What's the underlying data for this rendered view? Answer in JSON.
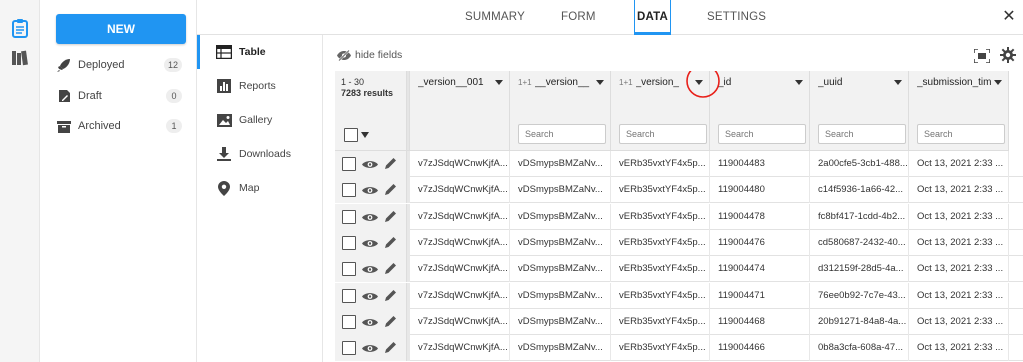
{
  "rail": {
    "icons": [
      "clipboard-icon",
      "library-icon"
    ]
  },
  "sidebar": {
    "new_label": "NEW",
    "items": [
      {
        "label": "Deployed",
        "count": "12",
        "icon": "rocket-icon"
      },
      {
        "label": "Draft",
        "count": "0",
        "icon": "draft-icon"
      },
      {
        "label": "Archived",
        "count": "1",
        "icon": "archive-icon"
      }
    ]
  },
  "nav": {
    "tabs": [
      "SUMMARY",
      "FORM",
      "DATA",
      "SETTINGS"
    ],
    "active": "DATA"
  },
  "data_nav": {
    "items": [
      {
        "label": "Table",
        "icon": "table-icon",
        "active": true
      },
      {
        "label": "Reports",
        "icon": "bar-chart-icon"
      },
      {
        "label": "Gallery",
        "icon": "image-icon"
      },
      {
        "label": "Downloads",
        "icon": "download-icon"
      },
      {
        "label": "Map",
        "icon": "map-pin-icon"
      }
    ]
  },
  "toolbar": {
    "hide_fields": "hide fields"
  },
  "table": {
    "range": "1 - 30",
    "results": "7283 results",
    "search_placeholder": "Search",
    "columns": [
      {
        "prefix": "",
        "title": "_version__001"
      },
      {
        "prefix": "1+1",
        "title": "__version__"
      },
      {
        "prefix": "1+1",
        "title": "_version_"
      },
      {
        "prefix": "",
        "title": "_id"
      },
      {
        "prefix": "",
        "title": "_uuid"
      },
      {
        "prefix": "",
        "title": "_submission_tim"
      }
    ],
    "rows": [
      [
        "v7zJSdqWCnwKjfA...",
        "vDSmypsBMZaNv...",
        "vERb35vxtYF4x5p...",
        "119004483",
        "2a00cfe5-3cb1-488...",
        "Oct 13, 2021 2:33 ..."
      ],
      [
        "v7zJSdqWCnwKjfA...",
        "vDSmypsBMZaNv...",
        "vERb35vxtYF4x5p...",
        "119004480",
        "c14f5936-1a66-42...",
        "Oct 13, 2021 2:33 ..."
      ],
      [
        "v7zJSdqWCnwKjfA...",
        "vDSmypsBMZaNv...",
        "vERb35vxtYF4x5p...",
        "119004478",
        "fc8bf417-1cdd-4b2...",
        "Oct 13, 2021 2:33 ..."
      ],
      [
        "v7zJSdqWCnwKjfA...",
        "vDSmypsBMZaNv...",
        "vERb35vxtYF4x5p...",
        "119004476",
        "cd580687-2432-40...",
        "Oct 13, 2021 2:33 ..."
      ],
      [
        "v7zJSdqWCnwKjfA...",
        "vDSmypsBMZaNv...",
        "vERb35vxtYF4x5p...",
        "119004474",
        "d312159f-28d5-4a...",
        "Oct 13, 2021 2:33 ..."
      ],
      [
        "v7zJSdqWCnwKjfA...",
        "vDSmypsBMZaNv...",
        "vERb35vxtYF4x5p...",
        "119004471",
        "76ee0b92-7c7e-43...",
        "Oct 13, 2021 2:33 ..."
      ],
      [
        "v7zJSdqWCnwKjfA...",
        "vDSmypsBMZaNv...",
        "vERb35vxtYF4x5p...",
        "119004468",
        "20b91271-84a8-4a...",
        "Oct 13, 2021 2:33 ..."
      ],
      [
        "v7zJSdqWCnwKjfA...",
        "vDSmypsBMZaNv...",
        "vERb35vxtYF4x5p...",
        "119004466",
        "0b8a3cfa-608a-47...",
        "Oct 13, 2021 2:33 ..."
      ]
    ]
  },
  "colors": {
    "accent": "#2095f2",
    "annotation": "#e8201a"
  }
}
